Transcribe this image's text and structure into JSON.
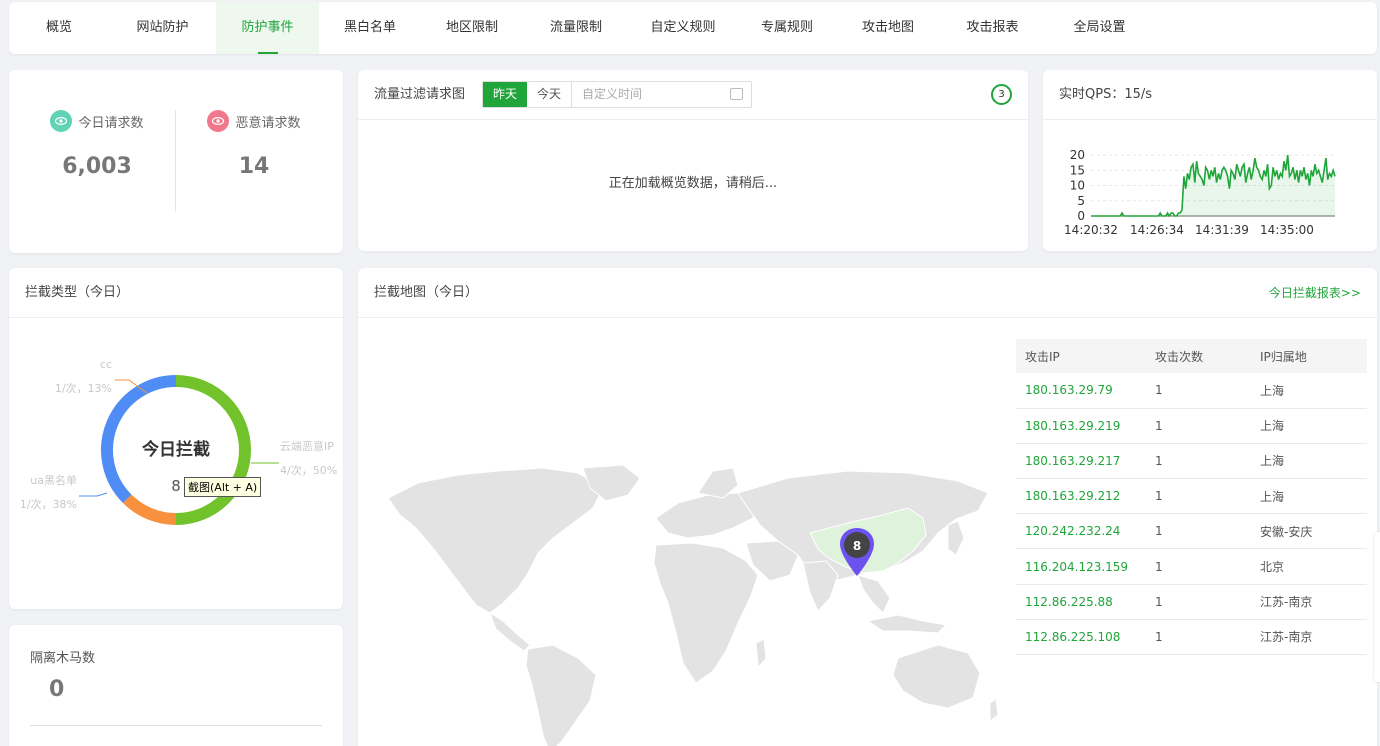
{
  "nav": {
    "tabs": [
      "概览",
      "网站防护",
      "防护事件",
      "黑白名单",
      "地区限制",
      "流量限制",
      "自定义规则",
      "专属规则",
      "攻击地图",
      "攻击报表",
      "全局设置"
    ],
    "active_index": 2
  },
  "stats": {
    "today_requests_label": "今日请求数",
    "today_requests_value": "6,003",
    "malicious_requests_label": "恶意请求数",
    "malicious_requests_value": "14"
  },
  "traffic": {
    "title": "流量过滤请求图",
    "date_options": [
      "昨天",
      "今天"
    ],
    "custom_placeholder": "自定义时间",
    "badge": "3",
    "loading": "正在加载概览数据，请稍后..."
  },
  "qps": {
    "title": "实时QPS：15/s"
  },
  "intercept_type": {
    "title": "拦截类型（今日）",
    "center_title": "今日拦截",
    "center_value": "8",
    "tooltip": "截图(Alt + A)",
    "colors": {
      "cloud": "#72c32b",
      "cc": "#f7913d",
      "ua": "#4f8df5"
    }
  },
  "trojan": {
    "title": "隔离木马数",
    "value": "0"
  },
  "map": {
    "title": "拦截地图（今日）",
    "report_link": "今日拦截报表>>",
    "pin_value": "8",
    "table": {
      "headers": [
        "攻击IP",
        "攻击次数",
        "IP归属地"
      ],
      "rows": [
        [
          "180.163.29.79",
          "1",
          "上海"
        ],
        [
          "180.163.29.219",
          "1",
          "上海"
        ],
        [
          "180.163.29.217",
          "1",
          "上海"
        ],
        [
          "180.163.29.212",
          "1",
          "上海"
        ],
        [
          "120.242.232.24",
          "1",
          "安徽-安庆"
        ],
        [
          "116.204.123.159",
          "1",
          "北京"
        ],
        [
          "112.86.225.88",
          "1",
          "江苏-南京"
        ],
        [
          "112.86.225.108",
          "1",
          "江苏-南京"
        ]
      ]
    }
  },
  "chart_data": [
    {
      "type": "pie",
      "labels": [
        "云端恶意IP",
        "cc",
        "ua黑名单"
      ],
      "values": [
        4,
        1,
        3
      ],
      "percent_labels": [
        "4/次，50%",
        "1/次，13%",
        "1/次，38%"
      ],
      "legend_colors": [
        "#72c32b",
        "#f7913d",
        "#4f8df5"
      ]
    },
    {
      "type": "line",
      "x_ticks": [
        "14:20:32",
        "14:26:34",
        "14:31:39",
        "14:35:00"
      ],
      "y_ticks": [
        0,
        5,
        10,
        15,
        20
      ],
      "ylim": [
        0,
        22
      ],
      "color": "#20a53a",
      "values": [
        0,
        0,
        0,
        0,
        0,
        0,
        0,
        0,
        0,
        0,
        0,
        0,
        0,
        0,
        0,
        0,
        0,
        1,
        0,
        0,
        0,
        0,
        0,
        0,
        0,
        0,
        0,
        0,
        0,
        0,
        0,
        0,
        0,
        0,
        0,
        0,
        0,
        0,
        1,
        0,
        0,
        0,
        1,
        0,
        1,
        1,
        0,
        0,
        1,
        1,
        2,
        13,
        9,
        14,
        12,
        16,
        17,
        11,
        18,
        14,
        13,
        12,
        10,
        16,
        15,
        12,
        15,
        13,
        16,
        11,
        14,
        12,
        15,
        16,
        15,
        13,
        9,
        15,
        14,
        12,
        17,
        15,
        13,
        16,
        17,
        11,
        14,
        16,
        12,
        15,
        19,
        16,
        15,
        13,
        12,
        15,
        13,
        17,
        9,
        10,
        16,
        13,
        15,
        12,
        14,
        13,
        18,
        15,
        20,
        13,
        14,
        16,
        12,
        15,
        11,
        15,
        13,
        16,
        12,
        14,
        10,
        15,
        13,
        17,
        14,
        15,
        13,
        11,
        15,
        19,
        12,
        14,
        13,
        15,
        13
      ]
    }
  ]
}
